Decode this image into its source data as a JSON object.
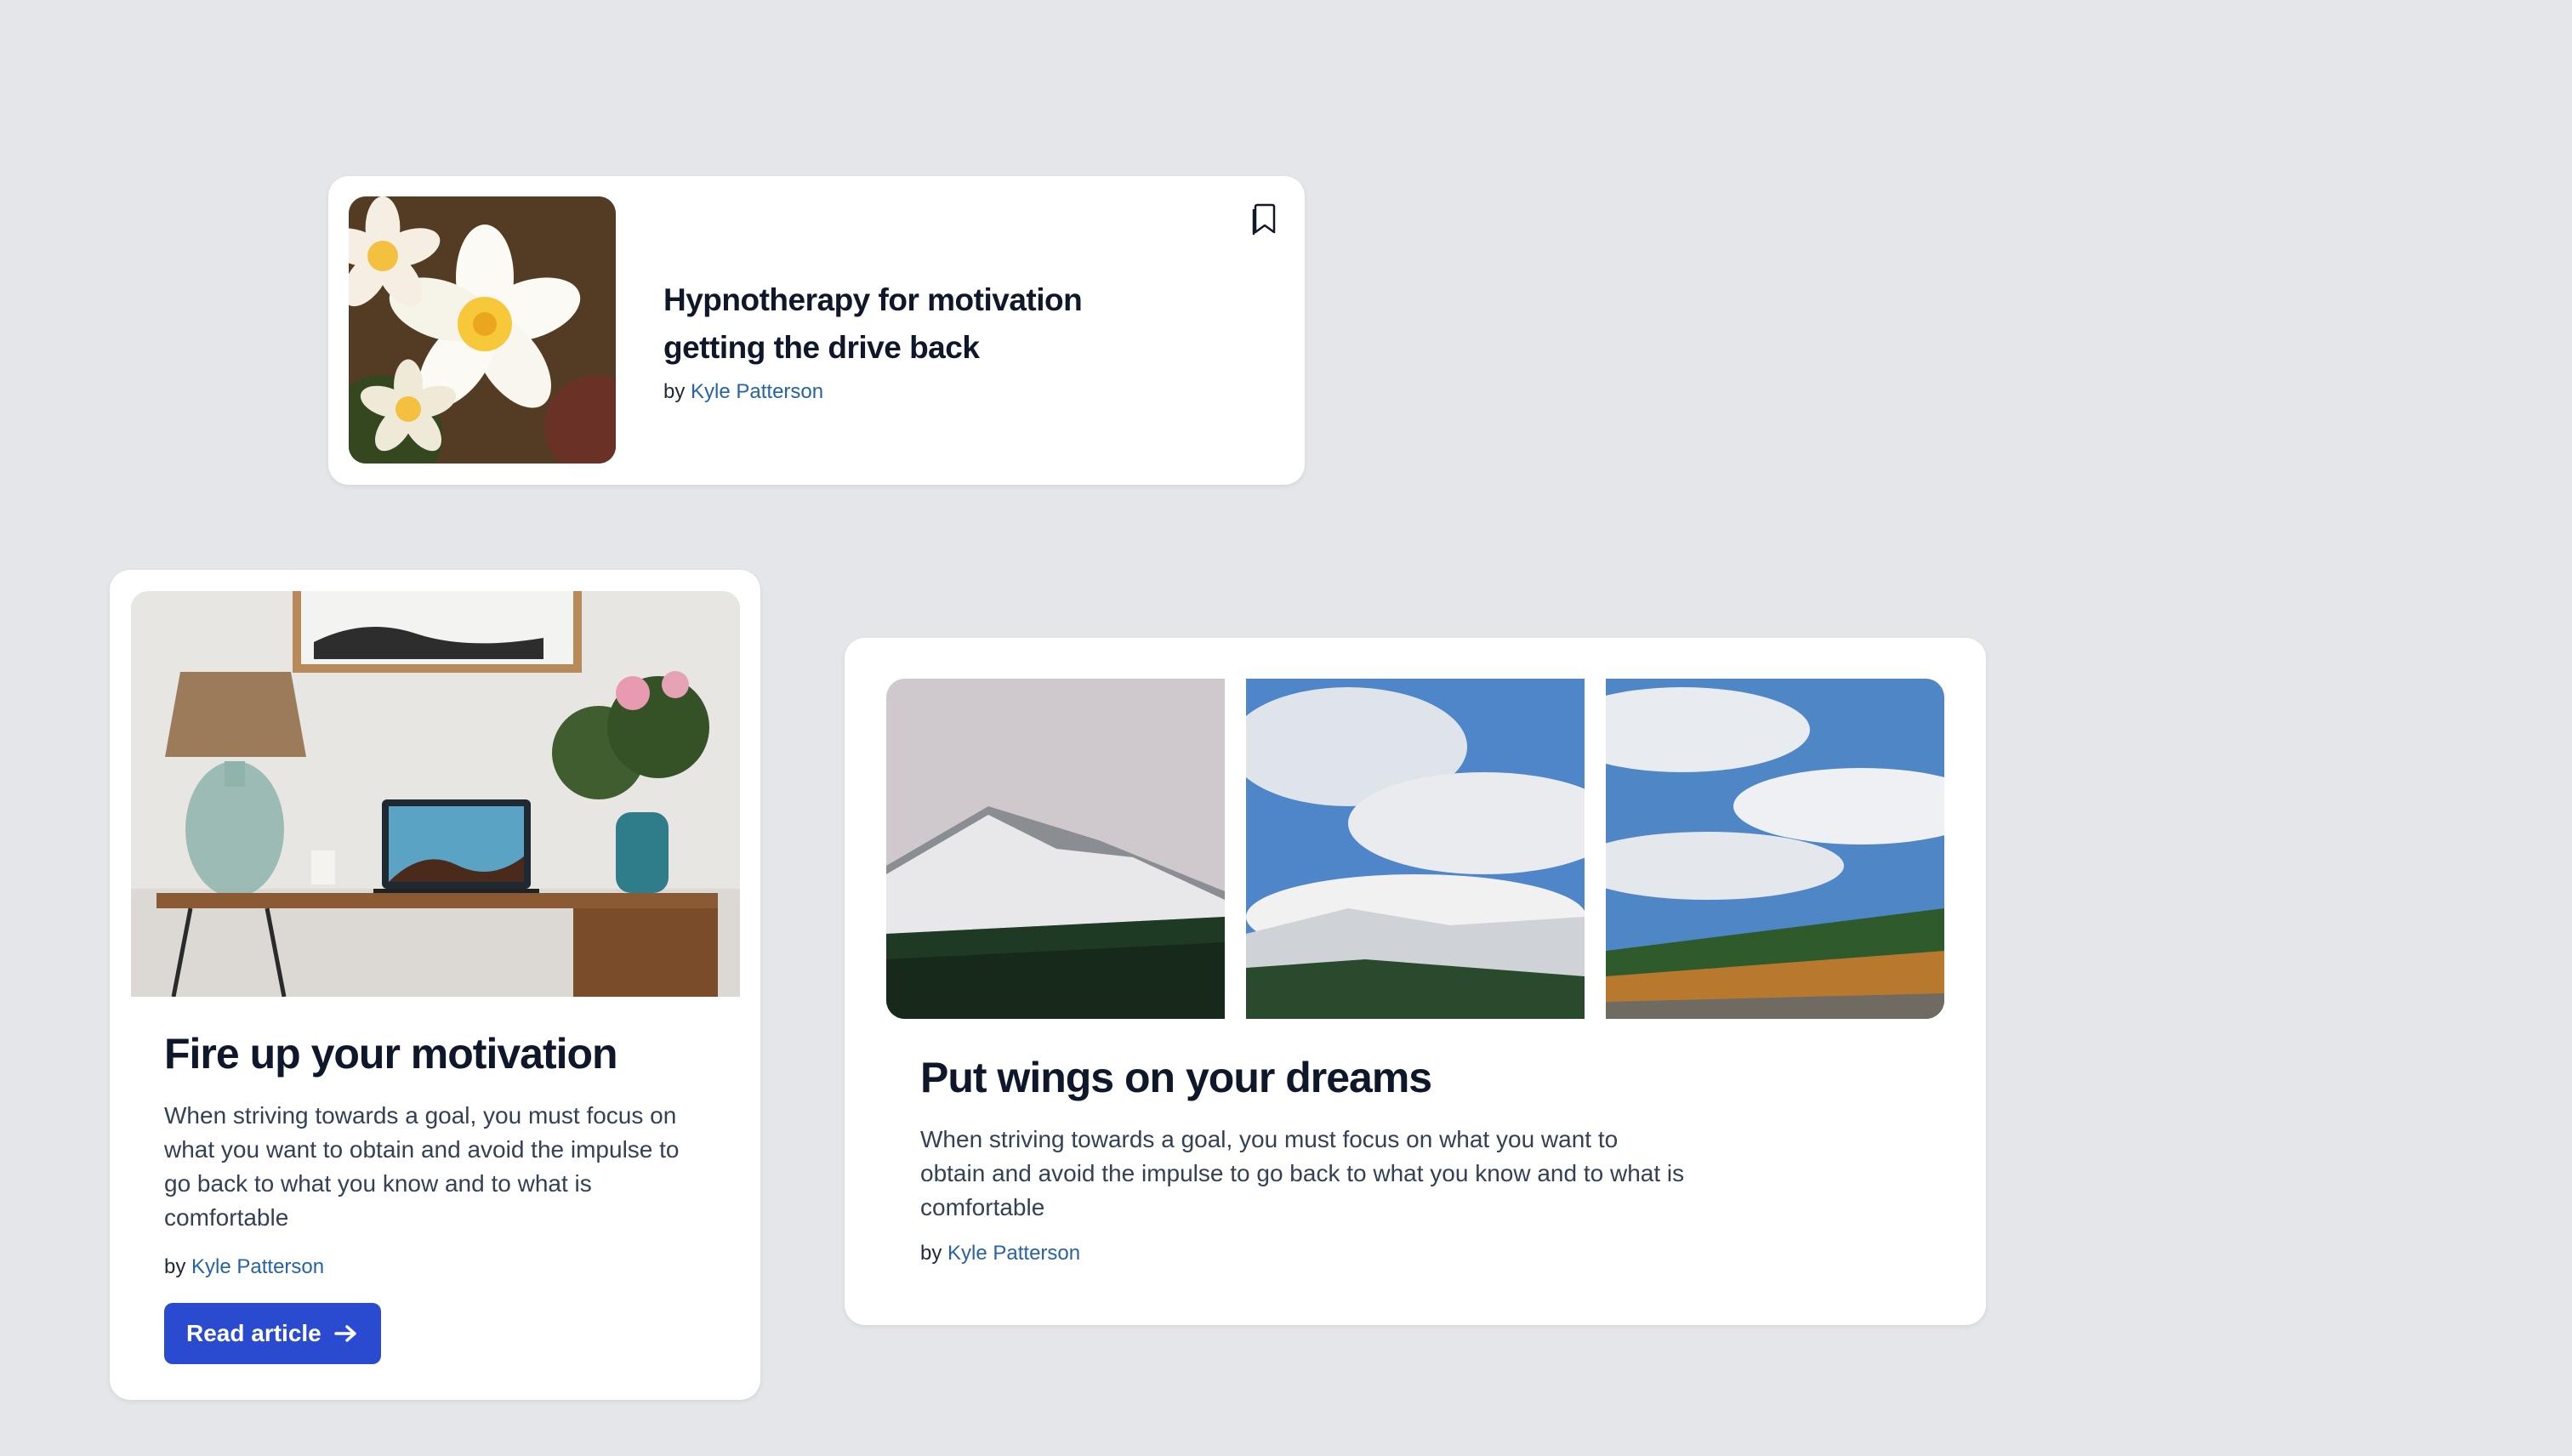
{
  "cards": [
    {
      "title": "Hypnotherapy for motivation getting the drive back",
      "byline_prefix": "by",
      "author": "Kyle Patterson",
      "image": "plumeria-flowers-photo",
      "icon": "bookmark-icon"
    },
    {
      "title": "Fire up your motivation",
      "description": "When striving towards a goal, you must focus on what you want to obtain and avoid the impulse to go back to what you know and to what is comfortable",
      "byline_prefix": "by",
      "author": "Kyle Patterson",
      "button_label": "Read article",
      "button_icon": "arrow-right-icon",
      "image": "desk-laptop-plant-photo"
    },
    {
      "title": "Put wings on your dreams",
      "description": "When striving towards a goal, you must focus on what you want to obtain and avoid the impulse to go back to what you know and to what is comfortable",
      "byline_prefix": "by",
      "author": "Kyle Patterson",
      "images": [
        "snowy-mountain-photo-1",
        "cloudy-mountain-photo-2",
        "forest-sky-photo-3"
      ]
    }
  ],
  "colors": {
    "background": "#e5e6ea",
    "card": "#ffffff",
    "link": "#2563a8",
    "button": "#2a4bd0",
    "title": "#0f172a"
  }
}
